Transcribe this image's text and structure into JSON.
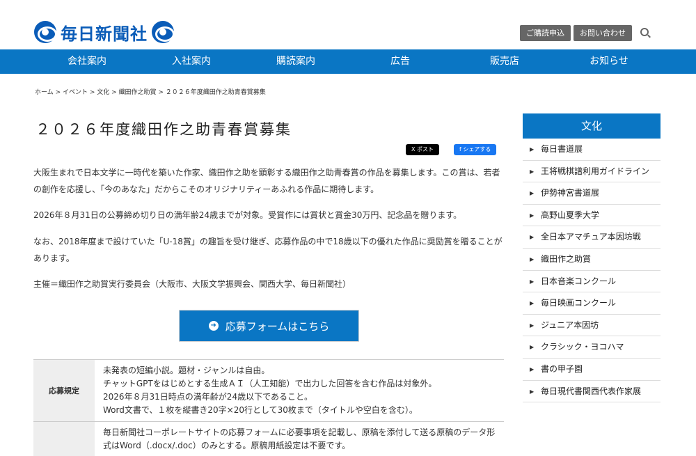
{
  "header": {
    "logo_text": "毎日新聞社",
    "subscribe_label": "ご購読申込",
    "contact_label": "お問い合わせ"
  },
  "nav": [
    "会社案内",
    "入社案内",
    "購読案内",
    "広告",
    "販売店",
    "お知らせ"
  ],
  "breadcrumb": "ホーム > イベント > 文化 > 織田作之助賞 > ２０２６年度織田作之助青春賞募集",
  "main": {
    "title": "２０２６年度織田作之助青春賞募集",
    "share_x": "X ポスト",
    "share_fb": "f シェアする",
    "paragraphs": [
      "大阪生まれで日本文学に一時代を築いた作家、織田作之助を顕彰する織田作之助青春賞の作品を募集します。この賞は、若者の創作を応援し、「今のあなた」だからこそのオリジナリティーあふれる作品に期待します。",
      "2026年８月31日の公募締め切り日の満年齢24歳までが対象。受賞作には賞状と賞金30万円、記念品を贈ります。",
      "なお、2018年度まで設けていた「U-18賞」の趣旨を受け継ぎ、応募作品の中で18歳以下の優れた作品に奨励賞を贈ることがあります。",
      "主催＝織田作之助賞実行委員会（大阪市、大阪文学振興会、関西大学、毎日新聞社）"
    ],
    "apply_label": "応募フォームはこちら",
    "rules": [
      {
        "head": "応募規定",
        "lines": [
          "未発表の短編小説。題材・ジャンルは自由。",
          "チャットGPTをはじめとする生成ＡＩ（人工知能）で出力した回答を含む作品は対象外。",
          "2026年８月31日時点の満年齢が24歳以下であること。",
          "Word文書で、１枚を縦書き20字×20行として30枚まで（タイトルや空白を含む）。"
        ]
      },
      {
        "head": "",
        "lines": [
          "毎日新聞社コーポレートサイトの応募フォームに必要事項を記載し、原稿を添付して送る原稿のデータ形式はWord（.docx/.doc）のみとする。原稿用紙設定は不要です。"
        ]
      }
    ]
  },
  "sidebar": {
    "title": "文化",
    "items": [
      "毎日書道展",
      "王将戦棋譜利用ガイドライン",
      "伊勢神宮書道展",
      "高野山夏季大学",
      "全日本アマチュア本因坊戦",
      "織田作之助賞",
      "日本音楽コンクール",
      "毎日映画コンクール",
      "ジュニア本因坊",
      "クラシック・ヨコハマ",
      "書の甲子園",
      "毎日現代書関西代表作家展"
    ]
  },
  "colors": {
    "brand_blue": "#0a76c4",
    "logo_blue": "#0a5cb8",
    "header_button": "#666666"
  }
}
